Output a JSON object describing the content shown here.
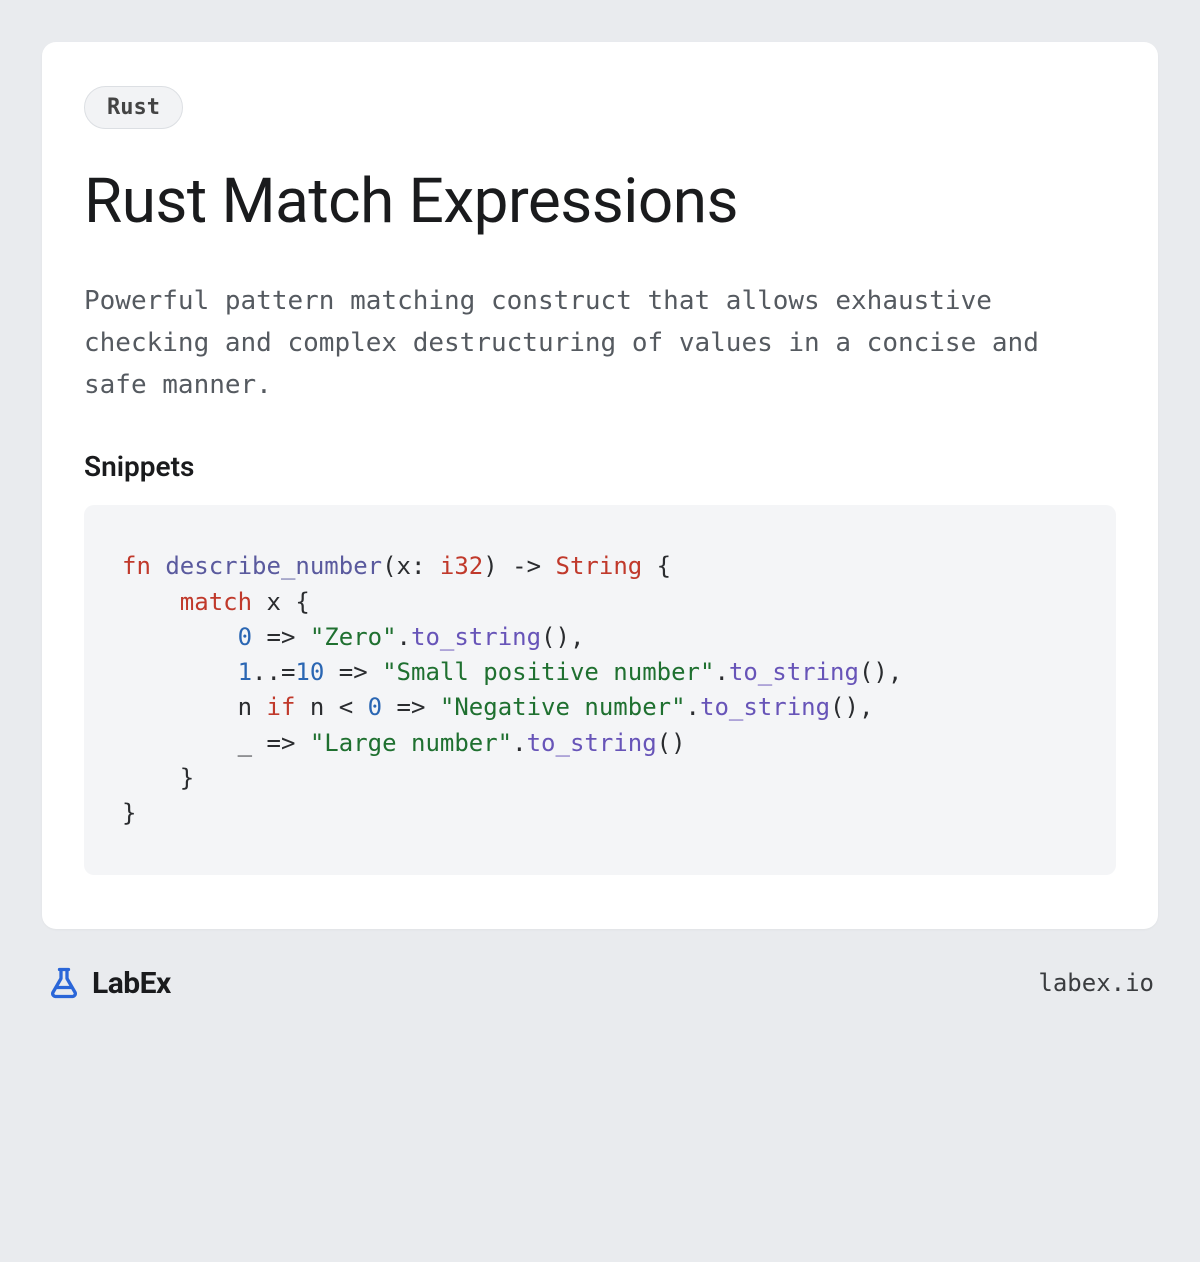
{
  "tag": "Rust",
  "title": "Rust Match Expressions",
  "description": "Powerful pattern matching construct that allows exhaustive checking and complex destructuring of values in a concise and safe manner.",
  "snippets_label": "Snippets",
  "code": {
    "line1": {
      "kw_fn": "fn",
      "fnname": "describe_number",
      "p1": "(x: ",
      "type1": "i32",
      "p2": ") -> ",
      "type2": "String",
      "p3": " {"
    },
    "line2": {
      "indent": "    ",
      "kw_match": "match",
      "rest": " x {"
    },
    "line3": {
      "indent": "        ",
      "num": "0",
      "p1": " => ",
      "str": "\"Zero\"",
      "dot": ".",
      "method": "to_string",
      "p2": "(),"
    },
    "line4": {
      "indent": "        ",
      "num1": "1",
      "range": "..=",
      "num2": "10",
      "p1": " => ",
      "str": "\"Small positive number\"",
      "dot": ".",
      "method": "to_string",
      "p2": "(),"
    },
    "line5": {
      "indent": "        ",
      "var": "n ",
      "kw_if": "if",
      "cond": " n < ",
      "num": "0",
      "p1": " => ",
      "str": "\"Negative number\"",
      "dot": ".",
      "method": "to_string",
      "p2": "(),"
    },
    "line6": {
      "indent": "        ",
      "wild": "_ => ",
      "str": "\"Large number\"",
      "dot": ".",
      "method": "to_string",
      "p2": "()"
    },
    "line7": {
      "indent": "    ",
      "brace": "}"
    },
    "line8": {
      "brace": "}"
    }
  },
  "brand_name": "LabEx",
  "site_url": "labex.io"
}
